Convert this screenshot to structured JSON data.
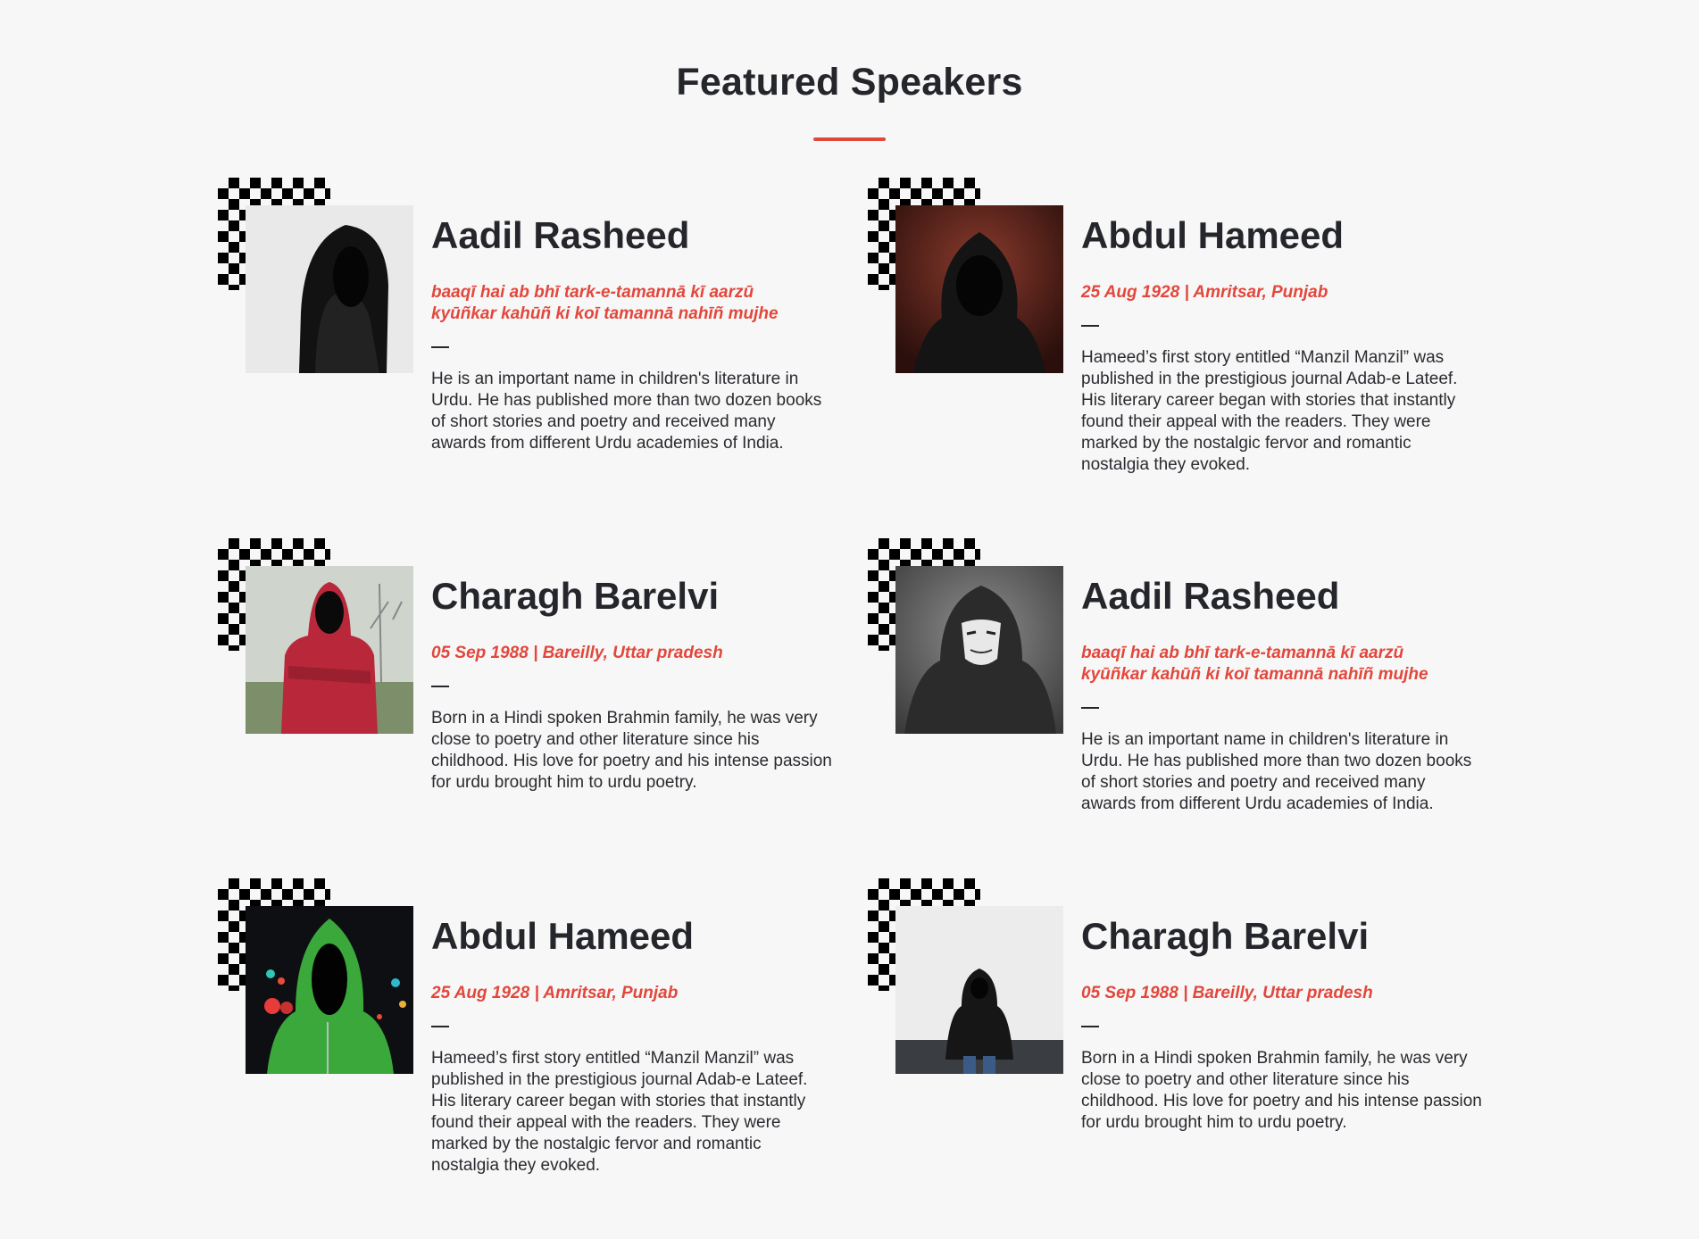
{
  "section": {
    "title": "Featured Speakers",
    "accent_color": "#e2473c"
  },
  "speakers": [
    {
      "name": "Aadil Rasheed",
      "subtitle_lines": [
        "baaqī hai ab bhī tark-e-tamannā kī aarzū",
        "kyūñkar kahūñ ki koī tamannā nahīñ mujhe"
      ],
      "bio": "He is an important name in children's literature in Urdu. He has published more than two dozen books of short stories and poetry and received many awards from different Urdu academies of India.",
      "photo": "hooded-figure-black-hoodie-on-white"
    },
    {
      "name": "Abdul Hameed",
      "subtitle_lines": [
        "25 Aug 1928 | Amritsar, Punjab"
      ],
      "bio": "Hameed’s first story entitled “Manzil Manzil” was published in the prestigious journal Adab-e Lateef. His literary career began with stories that instantly found their appeal with the readers. They were marked by the nostalgic fervor and romantic nostalgia they evoked.",
      "photo": "hooded-figure-dark-red-background"
    },
    {
      "name": "Charagh Barelvi",
      "subtitle_lines": [
        "05 Sep 1988 | Bareilly, Uttar pradesh"
      ],
      "bio": "Born in a Hindi spoken Brahmin family, he was very close to poetry and other literature since his childhood. His love for poetry and his intense passion for urdu brought him to urdu poetry.",
      "photo": "red-hoodie-figure-in-foggy-field"
    },
    {
      "name": "Aadil Rasheed",
      "subtitle_lines": [
        "baaqī hai ab bhī tark-e-tamannā kī aarzū",
        "kyūñkar kahūñ ki koī tamannā nahīñ mujhe"
      ],
      "bio": "He is an important name in children's literature in Urdu. He has published more than two dozen books of short stories and poetry and received many awards from different Urdu academies of India.",
      "photo": "masked-hooded-figure-in-smoke"
    },
    {
      "name": "Abdul Hameed",
      "subtitle_lines": [
        "25 Aug 1928 | Amritsar, Punjab"
      ],
      "bio": "Hameed’s first story entitled “Manzil Manzil” was published in the prestigious journal Adab-e Lateef. His literary career began with stories that instantly found their appeal with the readers. They were marked by the nostalgic fervor and romantic nostalgia they evoked.",
      "photo": "green-hoodie-figure-with-bokeh-lights"
    },
    {
      "name": "Charagh Barelvi",
      "subtitle_lines": [
        "05 Sep 1988 | Bareilly, Uttar pradesh"
      ],
      "bio": "Born in a Hindi spoken Brahmin family, he was very close to poetry and other literature since his childhood. His love for poetry and his intense passion for urdu brought him to urdu poetry.",
      "photo": "hooded-figure-against-white-wall"
    }
  ]
}
